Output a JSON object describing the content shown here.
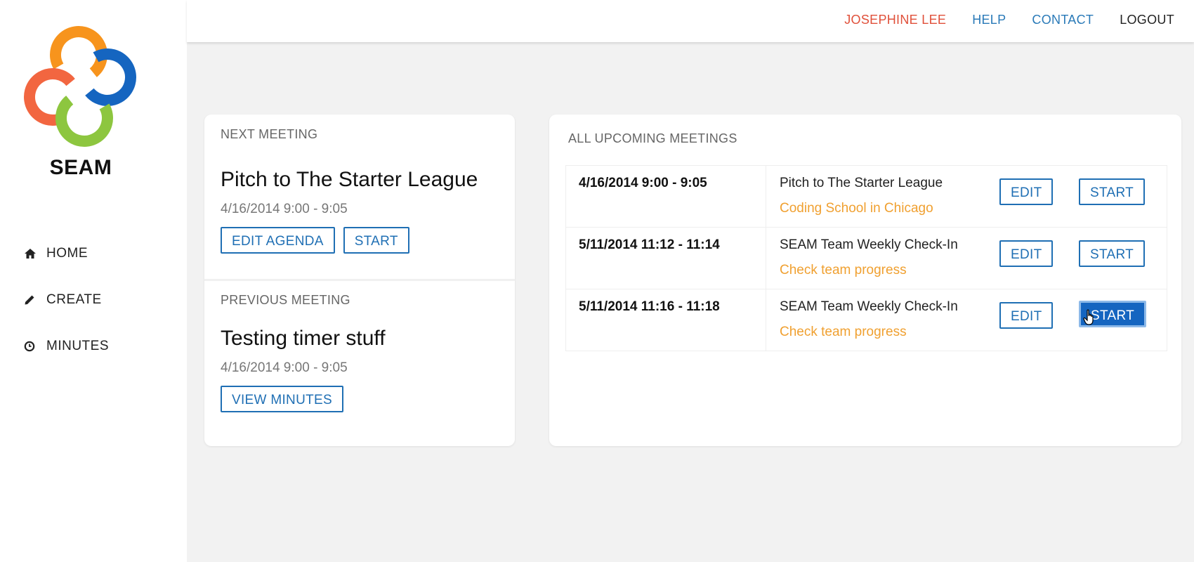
{
  "brand": {
    "name": "SEAM"
  },
  "colors": {
    "orange": "#f7941d",
    "blue": "#1565c0",
    "red": "#f26640",
    "green": "#8dc63f",
    "user": "#e0503a",
    "link": "#2a7ab8",
    "accent_text": "#f0a030"
  },
  "topbar": {
    "user": "JOSEPHINE LEE",
    "help": "HELP",
    "contact": "CONTACT",
    "logout": "LOGOUT"
  },
  "nav": [
    {
      "label": "HOME",
      "icon": "home-icon"
    },
    {
      "label": "CREATE",
      "icon": "pencil-icon"
    },
    {
      "label": "MINUTES",
      "icon": "clock-icon"
    }
  ],
  "next_meeting": {
    "section": "NEXT MEETING",
    "title": "Pitch to The Starter League",
    "date": "4/16/2014 9:00 - 9:05",
    "edit_label": "EDIT AGENDA",
    "start_label": "START"
  },
  "previous_meeting": {
    "section": "PREVIOUS MEETING",
    "title": "Testing timer stuff",
    "date": "4/16/2014 9:00 - 9:05",
    "view_label": "VIEW MINUTES"
  },
  "upcoming": {
    "section": "ALL UPCOMING MEETINGS",
    "rows": [
      {
        "datetime": "4/16/2014 9:00 - 9:05",
        "name": "Pitch to The Starter League",
        "desc": "Coding School in Chicago",
        "edit": "EDIT",
        "start": "START"
      },
      {
        "datetime": "5/11/2014 11:12 - 11:14",
        "name": "SEAM Team Weekly Check-In",
        "desc": "Check team progress",
        "edit": "EDIT",
        "start": "START"
      },
      {
        "datetime": "5/11/2014 11:16 - 11:18",
        "name": "SEAM Team Weekly Check-In",
        "desc": "Check team progress",
        "edit": "EDIT",
        "start": "START"
      }
    ]
  }
}
